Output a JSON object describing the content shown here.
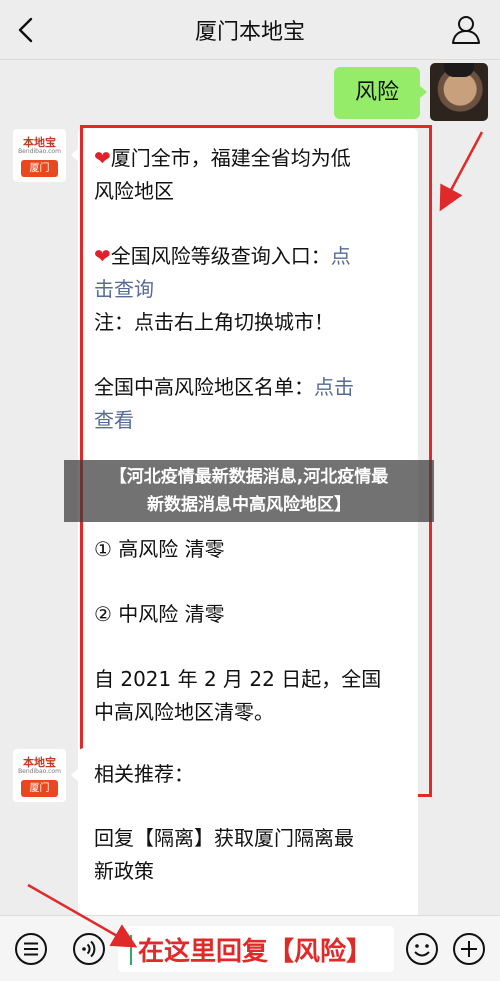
{
  "header": {
    "title": "厦门本地宝"
  },
  "me_message": "风险",
  "bot": {
    "logo_cn": "本地宝",
    "logo_url": "Bendibao.com",
    "logo_city": "厦门"
  },
  "reply1": {
    "l1": "厦门全市，福建全省均为低",
    "l2": "风险地区",
    "l3_text": "全国风险等级查询入口：",
    "l3_link": "点",
    "l4_link": "击查询",
    "l5": "注：点击右上角切换城市！",
    "l6_text": "全国中高风险地区名单：",
    "l6_link": "点击",
    "l7_link": "查看",
    "l8": "① 高风险 清零",
    "l9": "② 中风险 清零",
    "l10": "自 2021 年 2 月 22 日起，全国",
    "l11": "中高风险地区清零。"
  },
  "reply2": {
    "l1": "相关推荐：",
    "l2": "回复【隔离】获取厦门隔离最",
    "l3": "新政策"
  },
  "banner": {
    "line1": "【河北疫情最新数据消息,河北疫情最",
    "line2": "新数据消息中高风险地区】"
  },
  "input": {
    "callout": "在这里回复【风险】"
  },
  "colors": {
    "bubble_green": "#95ec69",
    "link": "#576b95",
    "annotation_red": "#e02a2a"
  },
  "icons": [
    "back-icon",
    "user-icon",
    "menu-icon",
    "voice-icon",
    "emoji-icon",
    "plus-icon",
    "heart-icon"
  ]
}
